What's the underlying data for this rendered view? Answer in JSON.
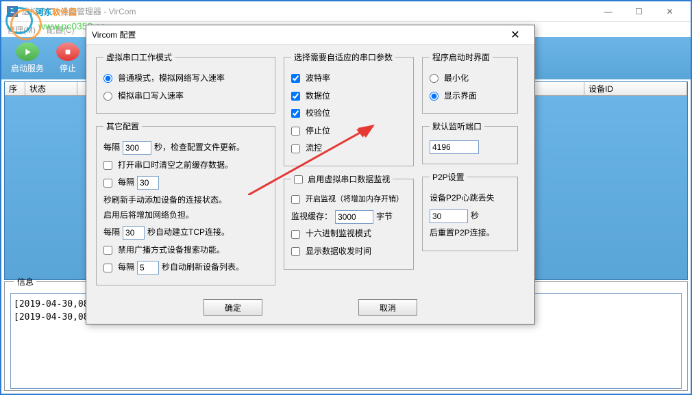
{
  "main_window": {
    "title": "虚拟串口&设备管理器 - VirCom",
    "menus": {
      "manage": "管理(M)",
      "config": "配置(C)",
      "vircom": "Vircom 配置"
    },
    "toolbar": {
      "start": "启动服务",
      "stop": "停止"
    },
    "win": {
      "min": "—",
      "max": "☐",
      "close": "✕"
    }
  },
  "grid": {
    "cols": {
      "seq": "序",
      "state": "状态",
      "devid": "设备ID"
    }
  },
  "info": {
    "legend": "信息",
    "log": "[2019-04-30,08:28:03] 创建成功。\n[2019-04-30,08:28:04] 在端口4196监听成功。"
  },
  "dialog": {
    "title": "Vircom 配置",
    "groups": {
      "workmode": {
        "legend": "虚拟串口工作模式",
        "opt_normal": "普通模式，模拟网络写入速率",
        "opt_sim": "模拟串口写入速率"
      },
      "other": {
        "legend": "其它配置",
        "interval_label_pre": "每隔",
        "interval_val": "300",
        "interval_label_post": "秒，检查配置文件更新。",
        "clear_cache": "打开串口时清空之前缓存数据。",
        "refresh_manual_val": "30",
        "refresh_manual_label": "秒刷新手动添加设备的连接状态。启用后将增加网络负担。",
        "tcp_pre": "每隔",
        "tcp_val": "30",
        "tcp_post": "秒自动建立TCP连接。",
        "no_broadcast": "禁用广播方式设备搜索功能。",
        "refresh_list_val": "5",
        "refresh_list_post": "秒自动刷新设备列表。",
        "refresh_manual_pre": "每隔",
        "refresh_list_pre": "每隔"
      },
      "serial_params": {
        "legend": "选择需要自适应的串口参数",
        "baud": "波特率",
        "databits": "数据位",
        "parity": "校验位",
        "stopbits": "停止位",
        "flow": "流控"
      },
      "monitor": {
        "legend": "启用虚拟串口数据监视",
        "enable_mem": "开启监视（将增加内存开销）",
        "cache_pre": "监视缓存：",
        "cache_val": "3000",
        "cache_post": "字节",
        "hex": "十六进制监视模式",
        "show_time": "显示数据收发时间"
      },
      "startup": {
        "legend": "程序启动时界面",
        "min": "最小化",
        "show": "显示界面"
      },
      "listen": {
        "legend": "默认监听端口",
        "port": "4196"
      },
      "p2p": {
        "legend": "P2P设置",
        "line1": "设备P2P心跳丢失",
        "val": "30",
        "unit": "秒",
        "line2": "后重置P2P连接。"
      }
    },
    "buttons": {
      "ok": "确定",
      "cancel": "取消"
    }
  },
  "watermark": {
    "text1": "河东",
    "text2": "软件园",
    "url": "www.pc0359.cn"
  }
}
